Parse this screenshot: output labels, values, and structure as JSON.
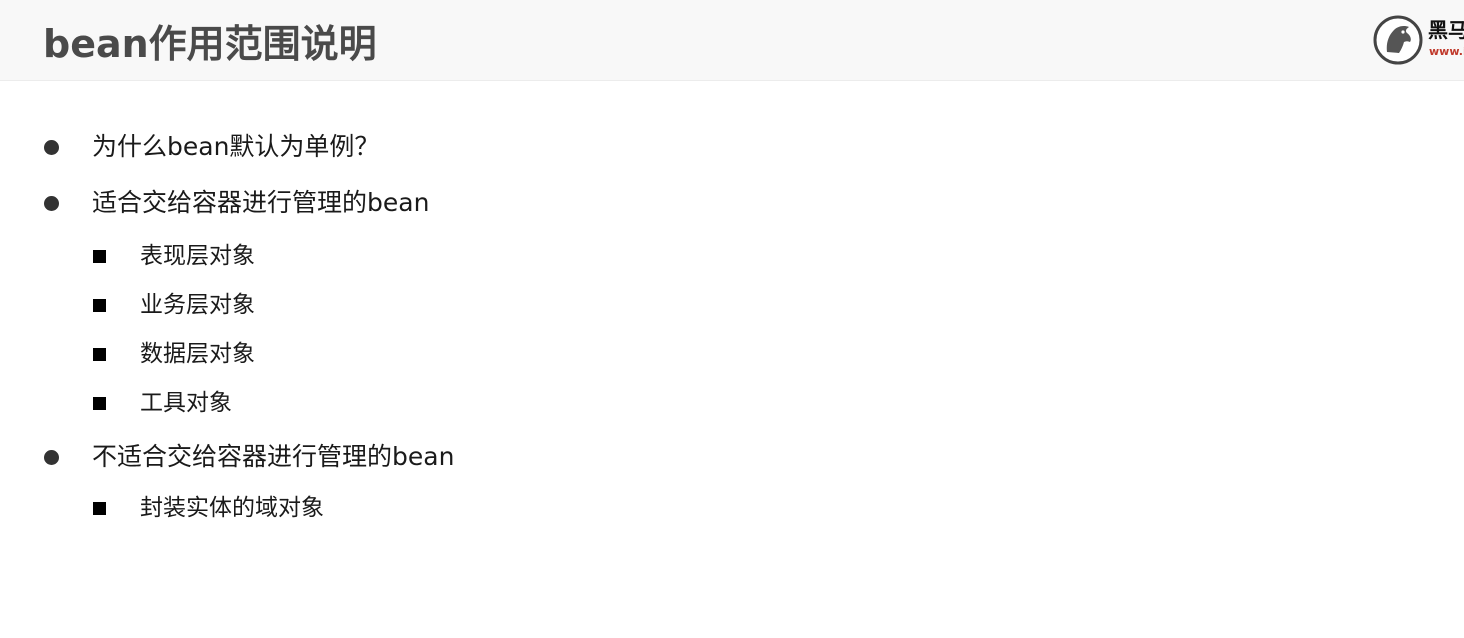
{
  "slide": {
    "title": "bean作用范围说明",
    "logo": {
      "icon": "horse-head-logo-icon",
      "name": "黑马",
      "url": "www.i"
    }
  },
  "content": {
    "items": [
      {
        "text": "为什么bean默认为单例？"
      },
      {
        "text": "适合交给容器进行管理的bean",
        "subitems": [
          "表现层对象",
          "业务层对象",
          "数据层对象",
          "工具对象"
        ]
      },
      {
        "text": "不适合交给容器进行管理的bean",
        "subitems": [
          "封装实体的域对象"
        ]
      }
    ]
  },
  "colors": {
    "header_background": "#f8f8f8",
    "title_text": "#4a4a4a",
    "body_text": "#1a1a1a",
    "logo_url": "#c0392b"
  }
}
